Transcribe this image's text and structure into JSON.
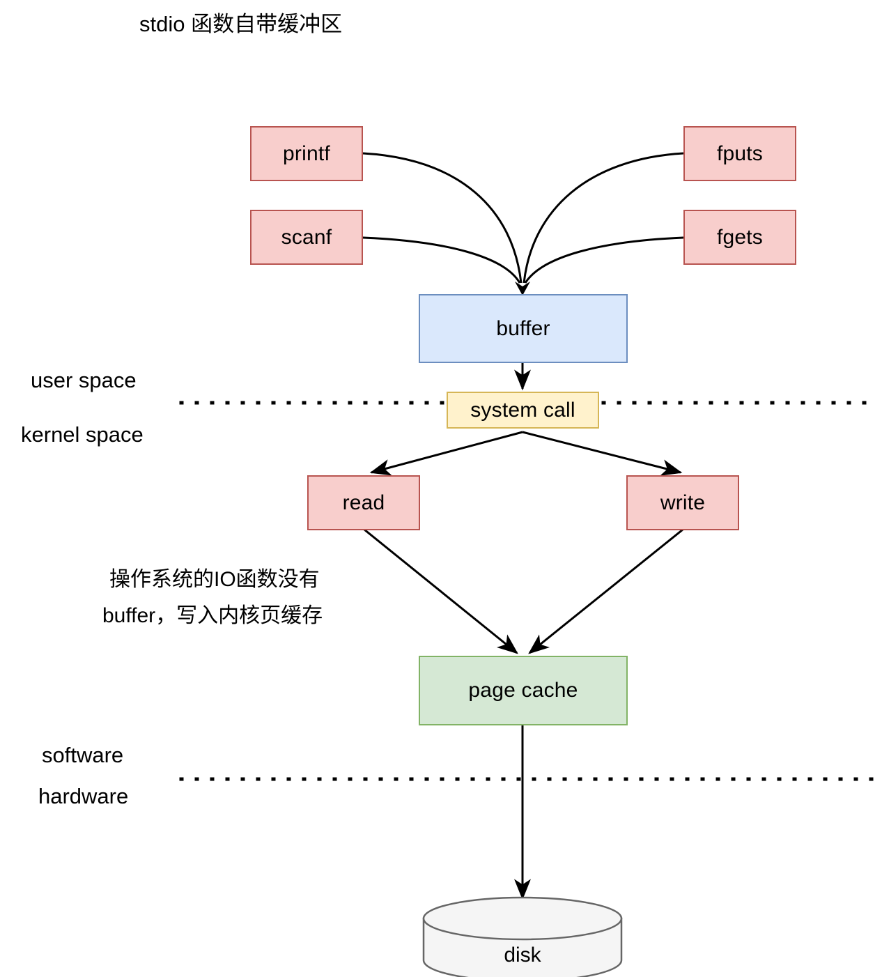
{
  "diagram": {
    "title": "stdio 函数自带缓冲区",
    "annotation_line1": "操作系统的IO函数没有",
    "annotation_line2": "buffer，写入内核页缓存",
    "layer_labels": {
      "user_space": "user space",
      "kernel_space": "kernel space",
      "software": "software",
      "hardware": "hardware"
    },
    "nodes": {
      "printf": "printf",
      "fputs": "fputs",
      "scanf": "scanf",
      "fgets": "fgets",
      "buffer": "buffer",
      "system_call": "system call",
      "read": "read",
      "write": "write",
      "page_cache": "page cache",
      "disk": "disk"
    },
    "colors": {
      "stdio_fill": "#f8cecc",
      "stdio_stroke": "#b85450",
      "buffer_fill": "#dae8fc",
      "buffer_stroke": "#6c8ebf",
      "syscall_fill": "#fff2cc",
      "syscall_stroke": "#d6b656",
      "cache_fill": "#d5e8d4",
      "cache_stroke": "#82b366",
      "disk_fill": "#f5f5f5",
      "disk_stroke": "#666666",
      "edge_stroke": "#000000",
      "background": "#ffffff"
    }
  }
}
